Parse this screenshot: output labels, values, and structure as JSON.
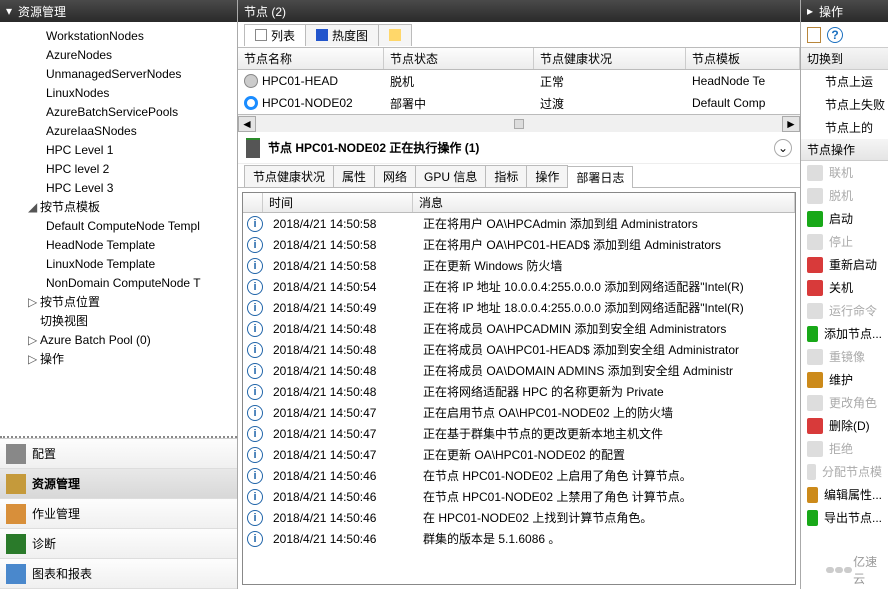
{
  "left_header": "资源管理",
  "tree": {
    "items": [
      {
        "label": "WorkstationNodes"
      },
      {
        "label": "AzureNodes"
      },
      {
        "label": "UnmanagedServerNodes"
      },
      {
        "label": "LinuxNodes"
      },
      {
        "label": "AzureBatchServicePools"
      },
      {
        "label": "AzureIaaSNodes"
      },
      {
        "label": "HPC Level 1"
      },
      {
        "label": "HPC level 2"
      },
      {
        "label": "HPC Level 3"
      }
    ],
    "groups": [
      {
        "label": "按节点模板",
        "expanded": true,
        "children": [
          "Default ComputeNode Templ",
          "HeadNode Template",
          "LinuxNode Template",
          "NonDomain ComputeNode T"
        ]
      },
      {
        "label": "按节点位置",
        "expanded": false
      },
      {
        "label": "切换视图",
        "plain": true
      },
      {
        "label": "Azure Batch Pool (0)",
        "expanded": false
      },
      {
        "label": "操作",
        "expanded": false
      }
    ]
  },
  "nav": [
    "配置",
    "资源管理",
    "作业管理",
    "诊断",
    "图表和报表"
  ],
  "mid_header": "节点 (2)",
  "tabs": {
    "list": "列表",
    "heat": "热度图"
  },
  "grid": {
    "cols": [
      "节点名称",
      "节点状态",
      "节点健康状况",
      "节点模板"
    ],
    "rows": [
      {
        "name": "HPC01-HEAD",
        "state": "脱机",
        "health": "正常",
        "tmpl": "HeadNode Te"
      },
      {
        "name": "HPC01-NODE02",
        "state": "部署中",
        "health": "过渡",
        "tmpl": "Default Comp"
      }
    ]
  },
  "detail_title": "节点 HPC01-NODE02    正在执行操作 (1)",
  "subtabs": [
    "节点健康状况",
    "属性",
    "网络",
    "GPU 信息",
    "指标",
    "操作",
    "部署日志"
  ],
  "log_cols": {
    "time": "时间",
    "msg": "消息"
  },
  "logs": [
    {
      "t": "2018/4/21 14:50:58",
      "m": "正在将用户 OA\\HPCAdmin 添加到组 Administrators"
    },
    {
      "t": "2018/4/21 14:50:58",
      "m": "正在将用户 OA\\HPC01-HEAD$ 添加到组 Administrators"
    },
    {
      "t": "2018/4/21 14:50:58",
      "m": "正在更新 Windows 防火墙"
    },
    {
      "t": "2018/4/21 14:50:54",
      "m": "正在将 IP 地址 10.0.0.4:255.0.0.0 添加到网络适配器\"Intel(R)"
    },
    {
      "t": "2018/4/21 14:50:49",
      "m": "正在将 IP 地址 18.0.0.4:255.0.0.0 添加到网络适配器\"Intel(R)"
    },
    {
      "t": "2018/4/21 14:50:48",
      "m": "正在将成员 OA\\HPCADMIN 添加到安全组 Administrators"
    },
    {
      "t": "2018/4/21 14:50:48",
      "m": "正在将成员 OA\\HPC01-HEAD$ 添加到安全组 Administrator"
    },
    {
      "t": "2018/4/21 14:50:48",
      "m": "正在将成员 OA\\DOMAIN ADMINS 添加到安全组 Administr"
    },
    {
      "t": "2018/4/21 14:50:48",
      "m": "正在将网络适配器 HPC 的名称更新为 Private"
    },
    {
      "t": "2018/4/21 14:50:47",
      "m": "正在启用节点 OA\\HPC01-NODE02 上的防火墙"
    },
    {
      "t": "2018/4/21 14:50:47",
      "m": "正在基于群集中节点的更改更新本地主机文件"
    },
    {
      "t": "2018/4/21 14:50:47",
      "m": "正在更新 OA\\HPC01-NODE02 的配置"
    },
    {
      "t": "2018/4/21 14:50:46",
      "m": "在节点 HPC01-NODE02 上启用了角色 计算节点。"
    },
    {
      "t": "2018/4/21 14:50:46",
      "m": "在节点 HPC01-NODE02 上禁用了角色 计算节点。"
    },
    {
      "t": "2018/4/21 14:50:46",
      "m": "在 HPC01-NODE02 上找到计算节点角色。"
    },
    {
      "t": "2018/4/21 14:50:46",
      "m": "群集的版本是 5.1.6086 。"
    }
  ],
  "right": {
    "header": "操作",
    "switch": "切换到",
    "switch_items": [
      "节点上运",
      "节点上失败",
      "节点上的"
    ],
    "node_ops_hdr": "节点操作",
    "ops": [
      {
        "l": "联机",
        "c": "#43c843",
        "dis": true
      },
      {
        "l": "脱机",
        "c": "#888",
        "dis": true
      },
      {
        "l": "启动",
        "c": "#18a818"
      },
      {
        "l": "停止",
        "c": "#888",
        "dis": true
      },
      {
        "l": "重新启动",
        "c": "#d83a3a"
      },
      {
        "l": "关机",
        "c": "#d83a3a"
      },
      {
        "l": "运行命令",
        "c": "#888",
        "dis": true
      },
      {
        "l": "添加节点...",
        "c": "#18a818"
      },
      {
        "l": "重镜像",
        "c": "#888",
        "dis": true
      },
      {
        "l": "维护",
        "c": "#cc8a1a"
      },
      {
        "l": "更改角色",
        "c": "#888",
        "dis": true
      },
      {
        "l": "删除(D)",
        "c": "#d83a3a"
      },
      {
        "l": "拒绝",
        "c": "#888",
        "dis": true
      },
      {
        "l": "分配节点模",
        "c": "#888",
        "dis": true
      },
      {
        "l": "编辑属性...",
        "c": "#cc8a1a"
      },
      {
        "l": "导出节点...",
        "c": "#18a818"
      }
    ]
  },
  "watermark": "亿速云"
}
